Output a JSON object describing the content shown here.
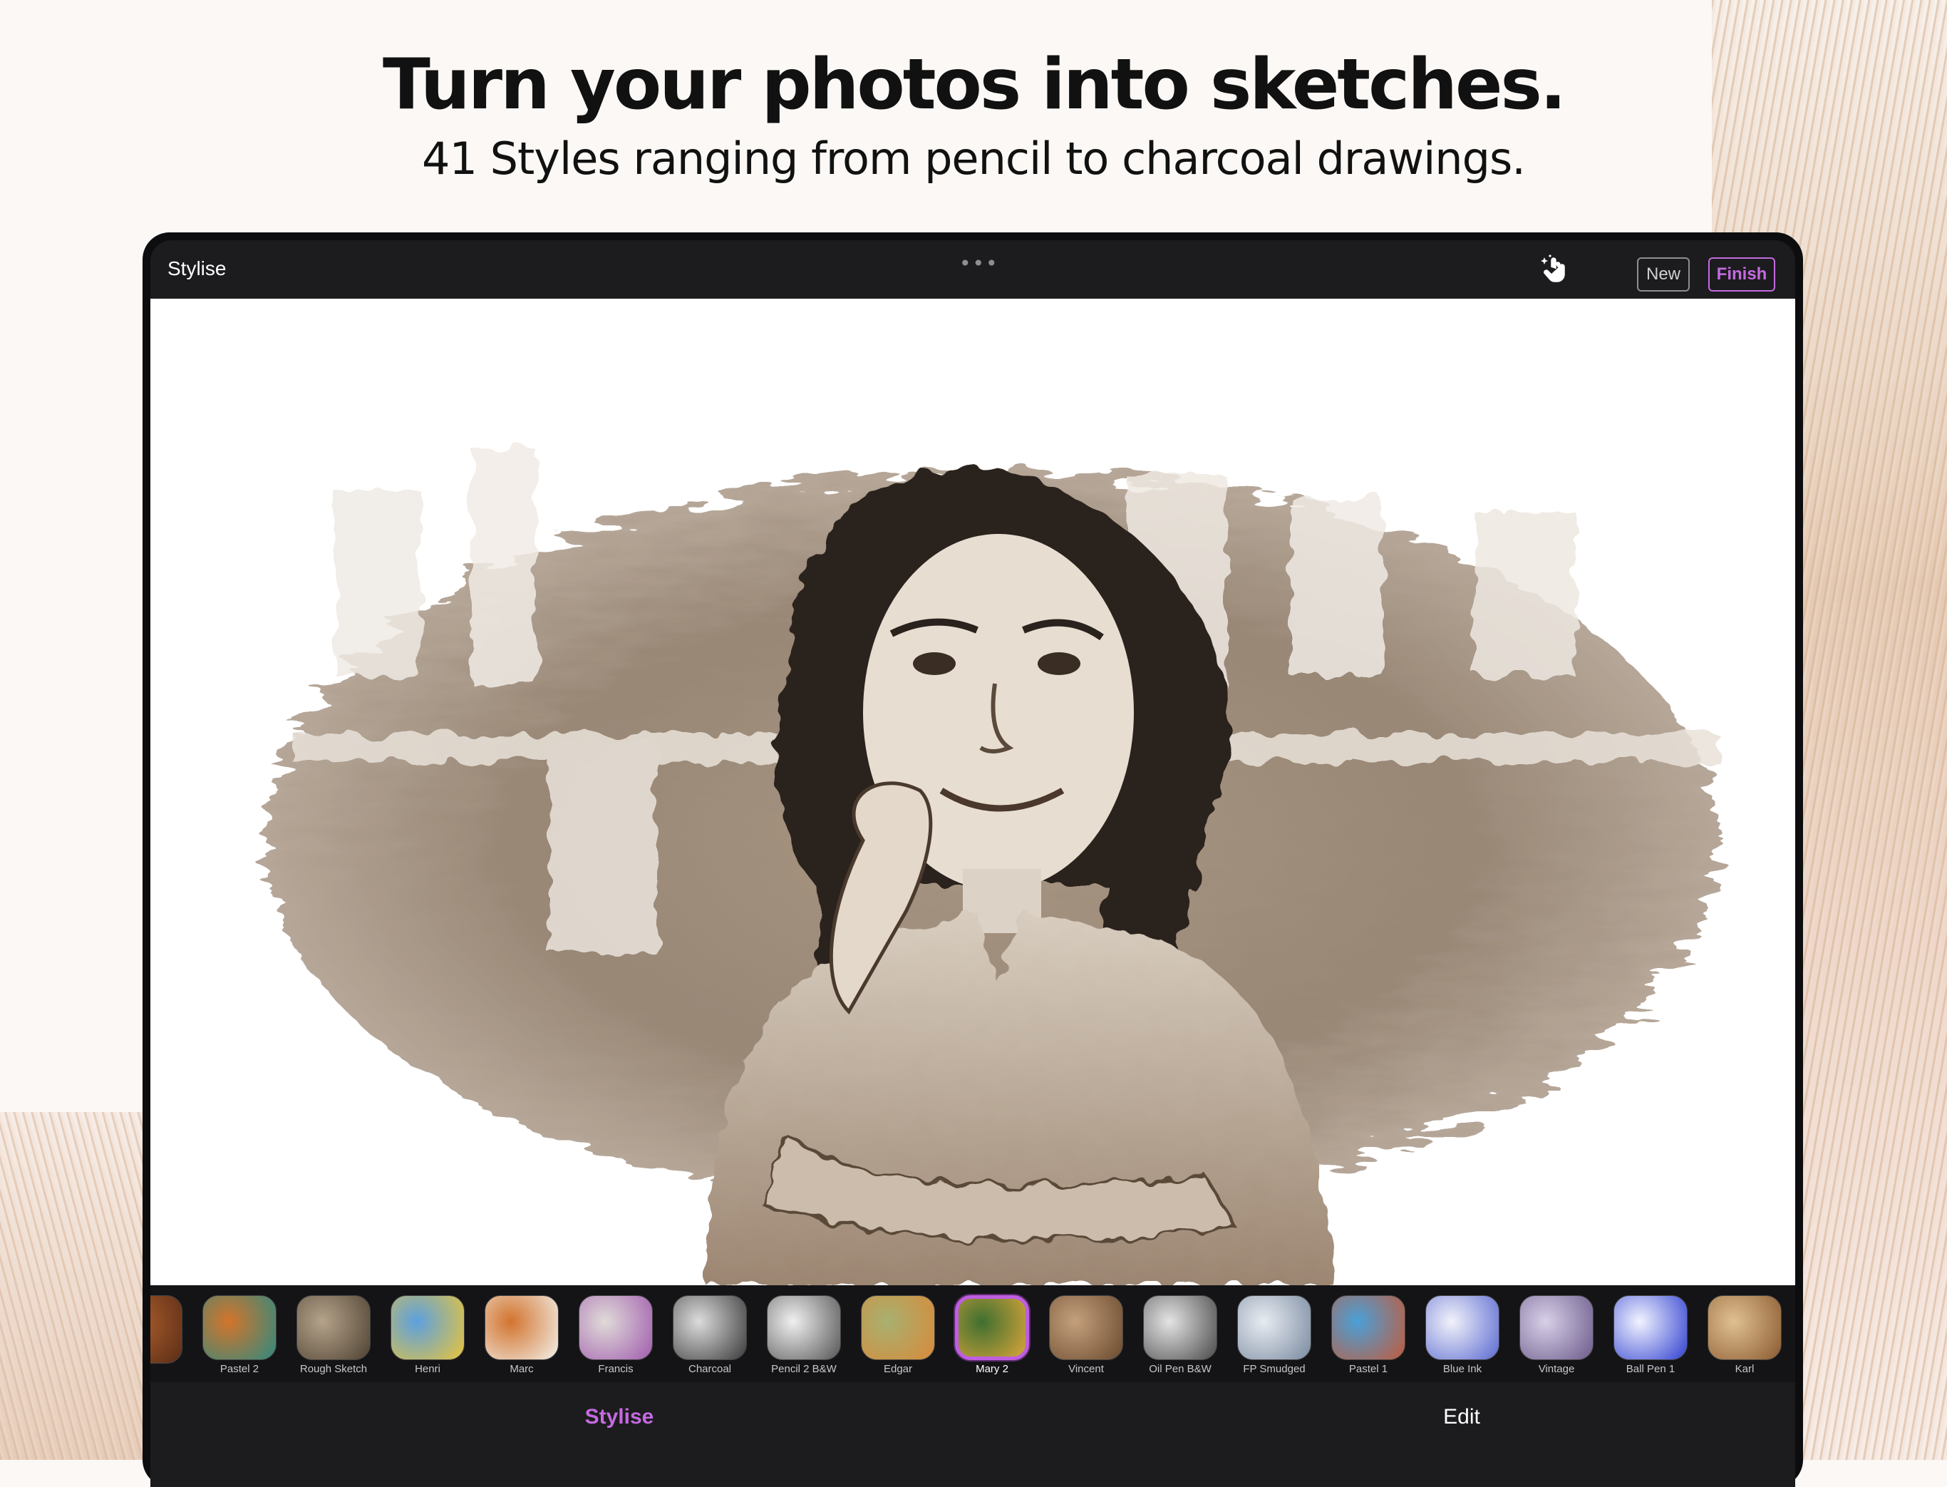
{
  "promo": {
    "headline": "Turn your photos into sketches.",
    "subline": "41 Styles ranging from pencil to charcoal drawings."
  },
  "topbar": {
    "title": "Stylise",
    "more_icon": "more-dots-icon",
    "magic_icon": "hand-tap-sparkle-icon",
    "new_label": "New",
    "finish_label": "Finish"
  },
  "canvas": {
    "image": "sepia sketch portrait",
    "accent": "#8a7560"
  },
  "styles": [
    {
      "label": "",
      "colors": [
        "#b0602a",
        "#5a2d18"
      ]
    },
    {
      "label": "Pastel 2",
      "colors": [
        "#d4742b",
        "#2e8a80"
      ]
    },
    {
      "label": "Rough Sketch",
      "colors": [
        "#b5a38a",
        "#4f4233"
      ]
    },
    {
      "label": "Henri",
      "colors": [
        "#5ca0e0",
        "#e9c53a"
      ]
    },
    {
      "label": "Marc",
      "colors": [
        "#d2742e",
        "#f3f0ea"
      ]
    },
    {
      "label": "Francis",
      "colors": [
        "#e0dbd8",
        "#a05cae"
      ]
    },
    {
      "label": "Charcoal",
      "colors": [
        "#dcdcdc",
        "#3a3a3a"
      ]
    },
    {
      "label": "Pencil 2 B&W",
      "colors": [
        "#f0f0f0",
        "#555555"
      ]
    },
    {
      "label": "Edgar",
      "colors": [
        "#a8b070",
        "#d88a3a"
      ]
    },
    {
      "label": "Mary 2",
      "colors": [
        "#3f6f30",
        "#d8a53a"
      ]
    },
    {
      "label": "Vincent",
      "colors": [
        "#c4a07c",
        "#6a4a2e"
      ]
    },
    {
      "label": "Oil Pen B&W",
      "colors": [
        "#e4e4e4",
        "#4a4a4a"
      ]
    },
    {
      "label": "FP Smudged",
      "colors": [
        "#e8ecf2",
        "#7a8aa0"
      ]
    },
    {
      "label": "Pastel 1",
      "colors": [
        "#4aa0d8",
        "#c25a3a"
      ]
    },
    {
      "label": "Blue Ink",
      "colors": [
        "#f2f2fa",
        "#5a6ad0"
      ]
    },
    {
      "label": "Vintage",
      "colors": [
        "#d8d0e8",
        "#6b5a8a"
      ]
    },
    {
      "label": "Ball Pen 1",
      "colors": [
        "#f2f4ff",
        "#3040d0"
      ]
    },
    {
      "label": "Karl",
      "colors": [
        "#e0c090",
        "#8a5a30"
      ]
    },
    {
      "label": "",
      "colors": [
        "#8a6a50",
        "#3a2a20"
      ]
    }
  ],
  "selected_style": "Mary 2",
  "tabs": {
    "stylise": "Stylise",
    "edit": "Edit"
  },
  "colors": {
    "accent": "#c46ae0",
    "bar": "#1c1c1e"
  }
}
